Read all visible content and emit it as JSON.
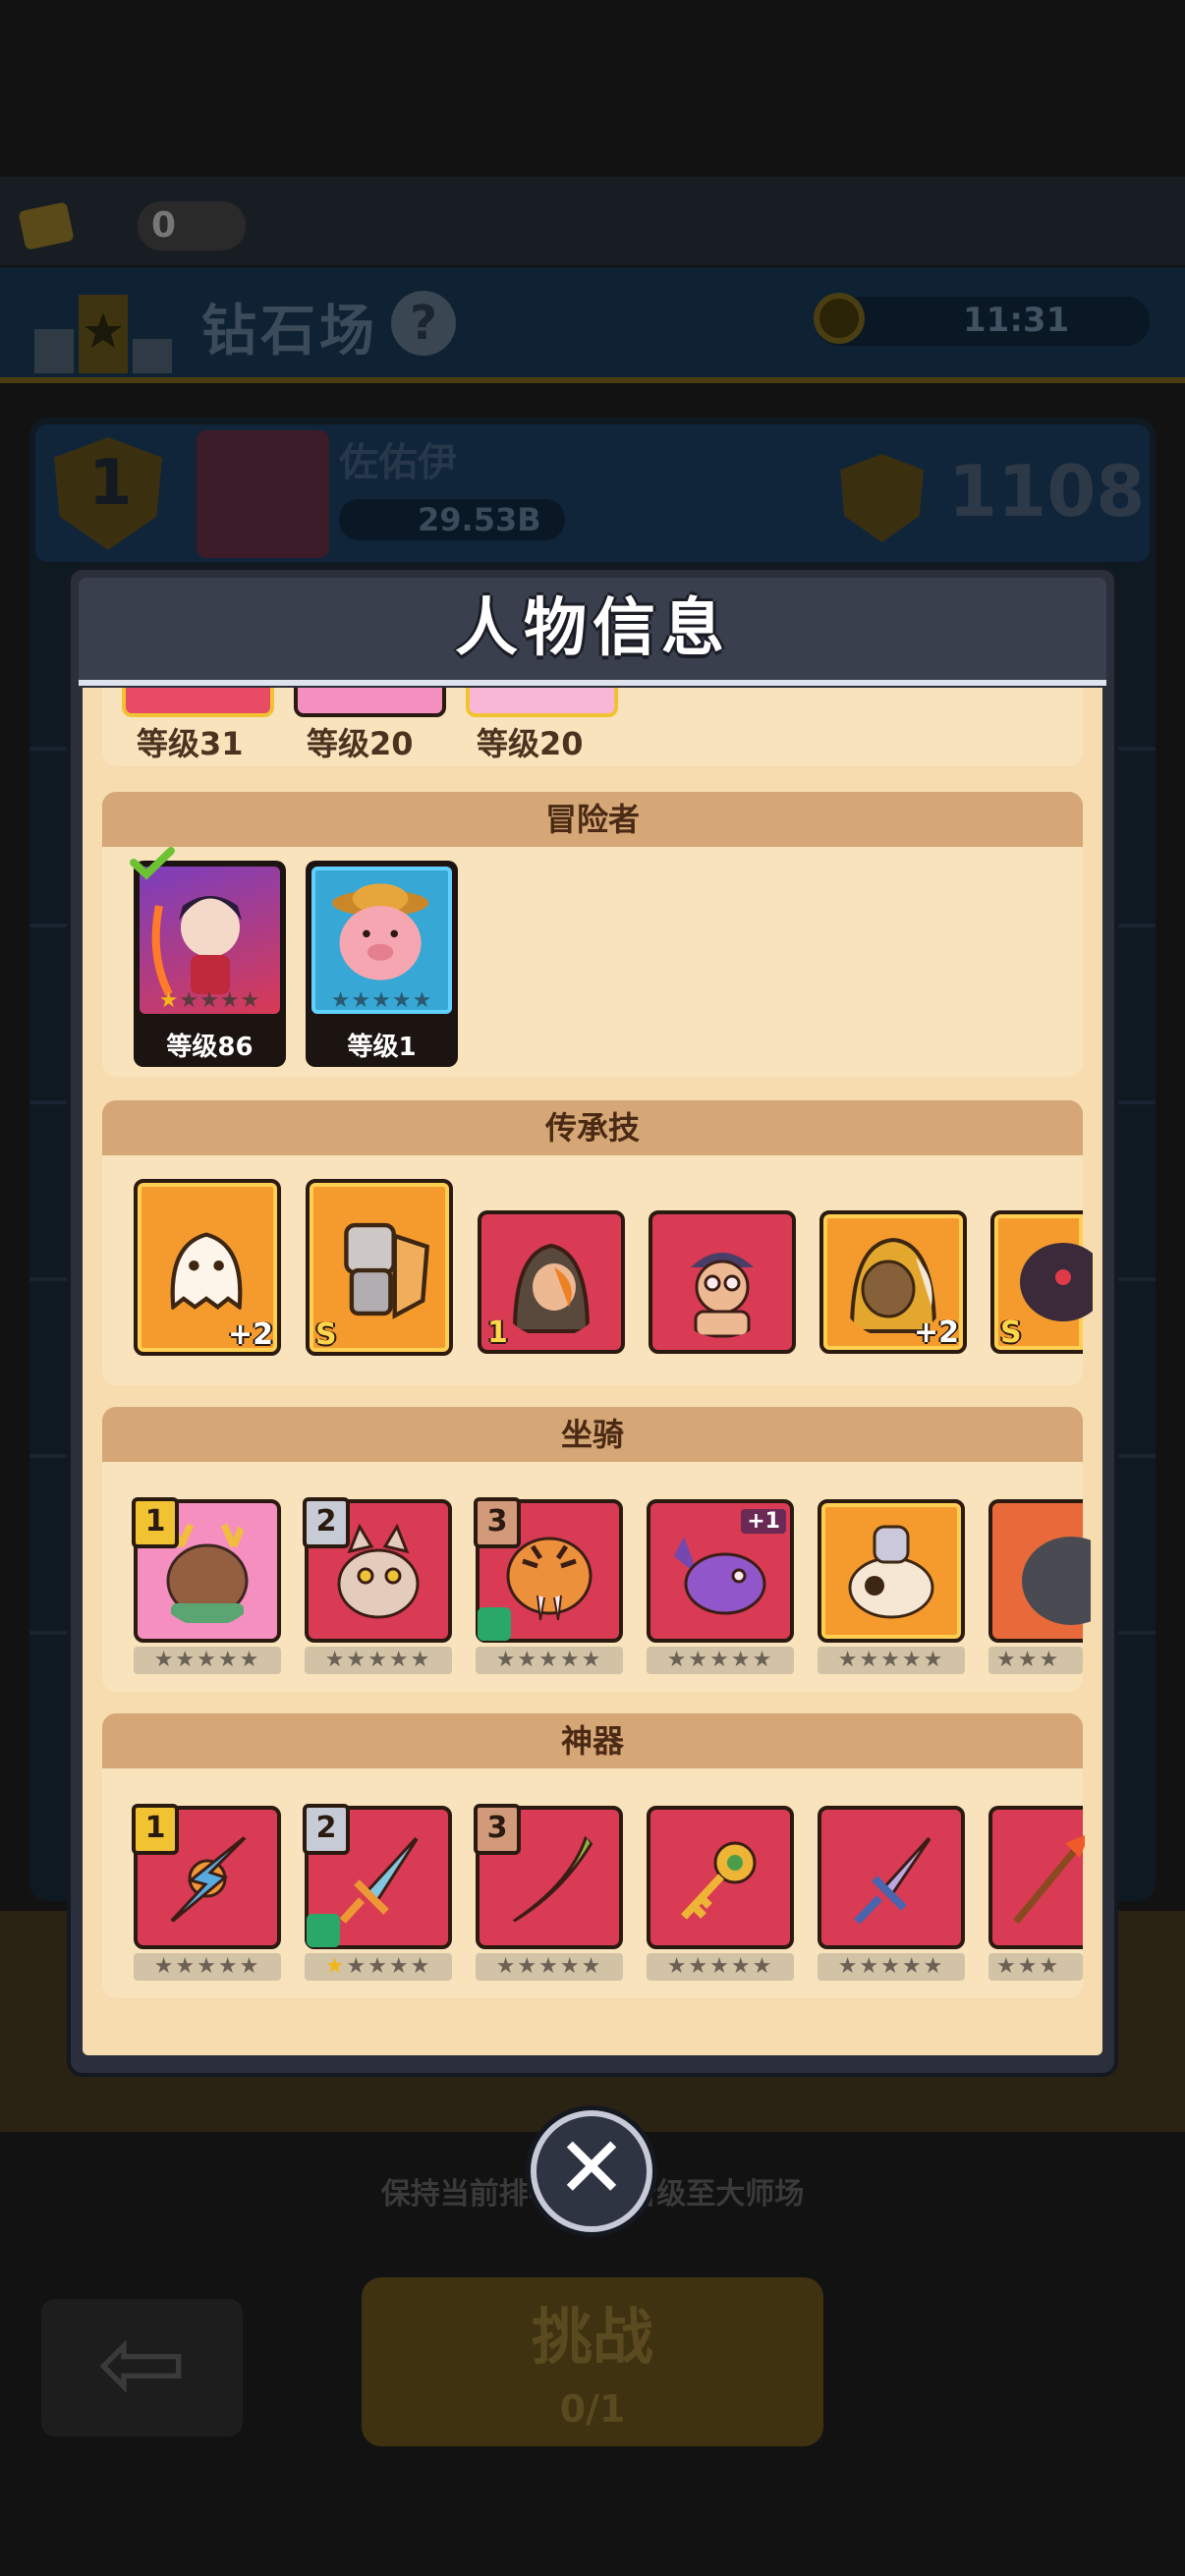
{
  "background": {
    "ticket_count": "0",
    "arena_title": "钻石场",
    "help_icon": "?",
    "timer": "11:31",
    "rank": "1",
    "player_name": "佐佑伊",
    "player_power": "29.53B",
    "score": "1108",
    "hint": "保持当前排名至          可晋级至大师场",
    "challenge_label": "挑战",
    "challenge_cost": "0/1",
    "back_icon": "⇦"
  },
  "modal": {
    "title": "人物信息",
    "top_levels": [
      "等级31",
      "等级20",
      "等级20"
    ],
    "adventurers": {
      "title": "冒险者",
      "items": [
        {
          "level": "等级86",
          "stars": 1,
          "selected": true
        },
        {
          "level": "等级1",
          "stars": 0,
          "selected": false
        }
      ]
    },
    "legacy_skills": {
      "title": "传承技",
      "items": [
        {
          "tag": "+2"
        },
        {
          "tag": "S"
        },
        {
          "tag": "1"
        },
        {
          "tag": ""
        },
        {
          "tag": "+2"
        },
        {
          "tag": "S"
        }
      ]
    },
    "mounts": {
      "title": "坐骑",
      "items": [
        {
          "badge": "1",
          "extra": "",
          "stars": 0
        },
        {
          "badge": "2",
          "extra": "",
          "stars": 0
        },
        {
          "badge": "3",
          "extra": "",
          "stars": 0
        },
        {
          "badge": "",
          "extra": "+1",
          "stars": 0
        },
        {
          "badge": "",
          "extra": "",
          "stars": 0
        },
        {
          "badge": "",
          "extra": "",
          "stars": 0
        }
      ]
    },
    "artifacts": {
      "title": "神器",
      "items": [
        {
          "badge": "1",
          "stars": 0
        },
        {
          "badge": "2",
          "stars": 1
        },
        {
          "badge": "3",
          "stars": 0
        },
        {
          "badge": "",
          "stars": 0
        },
        {
          "badge": "",
          "stars": 0
        },
        {
          "badge": "",
          "stars": 0
        }
      ]
    },
    "close_icon": "✕"
  },
  "colors": {
    "modal_frame": "#2b2f3c",
    "panel_bg": "#f6dcae",
    "section_header": "#d5a676",
    "card_red": "#d93a54",
    "card_orange": "#f59b2d",
    "card_gold_border": "#f1c232"
  }
}
